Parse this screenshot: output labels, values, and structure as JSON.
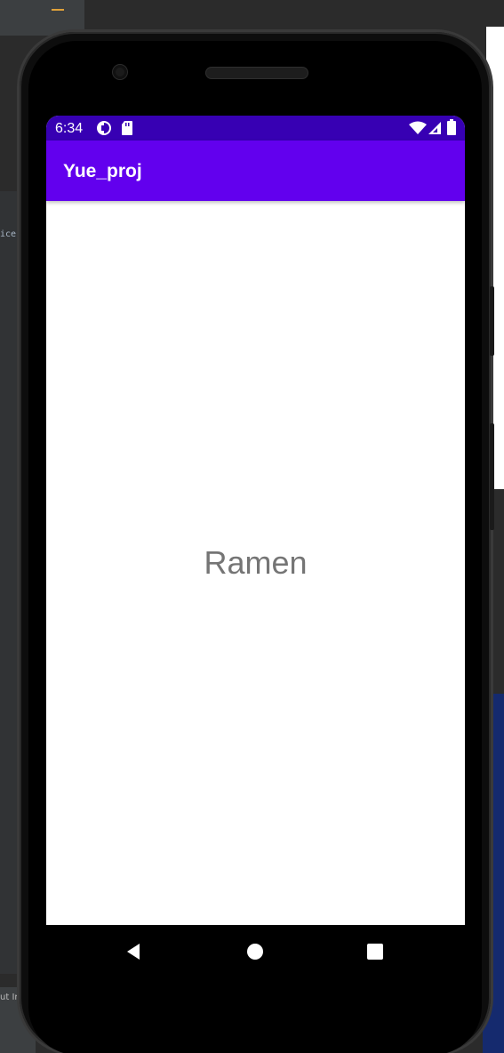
{
  "ide": {
    "code_fragment": "ice\"",
    "bottom_text": "ut In"
  },
  "device": {
    "status_bar": {
      "time": "6:34",
      "icons": [
        "data-saver-icon",
        "sd-card-icon",
        "wifi-icon",
        "cell-signal-icon",
        "battery-icon"
      ]
    },
    "app_bar": {
      "title": "Yue_proj"
    },
    "content": {
      "text": "Ramen"
    },
    "nav_bar": {
      "buttons": [
        "back-icon",
        "home-icon",
        "overview-icon"
      ]
    }
  },
  "colors": {
    "status_bar": "#3700b3",
    "app_bar": "#6200ee",
    "content_text": "#757575"
  }
}
